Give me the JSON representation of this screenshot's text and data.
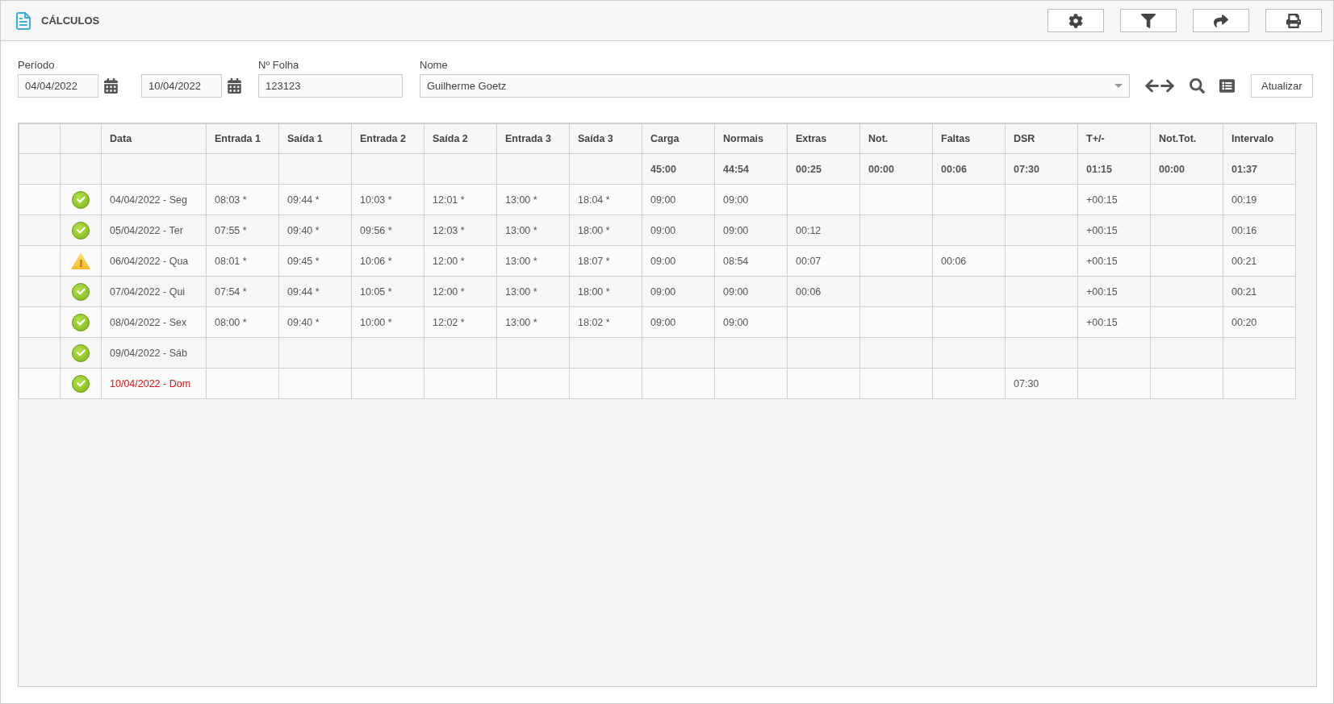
{
  "header": {
    "title": "CÁLCULOS"
  },
  "filters": {
    "period_label": "Período",
    "date_from": "04/04/2022",
    "date_to": "10/04/2022",
    "sheet_label": "Nº Folha",
    "sheet": "123123",
    "name_label": "Nome",
    "name": "Guilherme Goetz",
    "refresh": "Atualizar"
  },
  "table": {
    "columns": [
      "Data",
      "Entrada 1",
      "Saída 1",
      "Entrada 2",
      "Saída 2",
      "Entrada 3",
      "Saída 3",
      "Carga",
      "Normais",
      "Extras",
      "Not.",
      "Faltas",
      "DSR",
      "T+/-",
      "Not.Tot.",
      "Intervalo"
    ],
    "totals": [
      "45:00",
      "44:54",
      "00:25",
      "00:00",
      "00:06",
      "07:30",
      "01:15",
      "00:00",
      "01:37"
    ],
    "rows": [
      {
        "kind": "ok",
        "holiday": false,
        "cells": [
          "04/04/2022 - Seg",
          "08:03 *",
          "09:44 *",
          "10:03 *",
          "12:01 *",
          "13:00 *",
          "18:04 *",
          "09:00",
          "09:00",
          null,
          null,
          null,
          null,
          "+00:15",
          null,
          "00:19"
        ]
      },
      {
        "kind": "ok",
        "holiday": false,
        "cells": [
          "05/04/2022 - Ter",
          "07:55 *",
          "09:40 *",
          "09:56 *",
          "12:03 *",
          "13:00 *",
          "18:00 *",
          "09:00",
          "09:00",
          "00:12",
          null,
          null,
          null,
          "+00:15",
          null,
          "00:16"
        ]
      },
      {
        "kind": "warning",
        "holiday": false,
        "cells": [
          "06/04/2022 - Qua",
          "08:01 *",
          "09:45 *",
          "10:06 *",
          "12:00 *",
          "13:00 *",
          "18:07 *",
          "09:00",
          "08:54",
          "00:07",
          null,
          "00:06",
          null,
          "+00:15",
          null,
          "00:21"
        ]
      },
      {
        "kind": "ok",
        "holiday": false,
        "cells": [
          "07/04/2022 - Qui",
          "07:54 *",
          "09:44 *",
          "10:05 *",
          "12:00 *",
          "13:00 *",
          "18:00 *",
          "09:00",
          "09:00",
          "00:06",
          null,
          null,
          null,
          "+00:15",
          null,
          "00:21"
        ]
      },
      {
        "kind": "ok",
        "holiday": false,
        "cells": [
          "08/04/2022 - Sex",
          "08:00 *",
          "09:40 *",
          "10:00 *",
          "12:02 *",
          "13:00 *",
          "18:02 *",
          "09:00",
          "09:00",
          null,
          null,
          null,
          null,
          "+00:15",
          null,
          "00:20"
        ]
      },
      {
        "kind": "ok",
        "holiday": false,
        "cells": [
          "09/04/2022 - Sáb",
          null,
          null,
          null,
          null,
          null,
          null,
          null,
          null,
          null,
          null,
          null,
          null,
          null,
          null,
          null
        ]
      },
      {
        "kind": "ok",
        "holiday": true,
        "cells": [
          "10/04/2022 - Dom",
          null,
          null,
          null,
          null,
          null,
          null,
          null,
          null,
          null,
          null,
          null,
          "07:30",
          null,
          null,
          null
        ]
      }
    ]
  }
}
